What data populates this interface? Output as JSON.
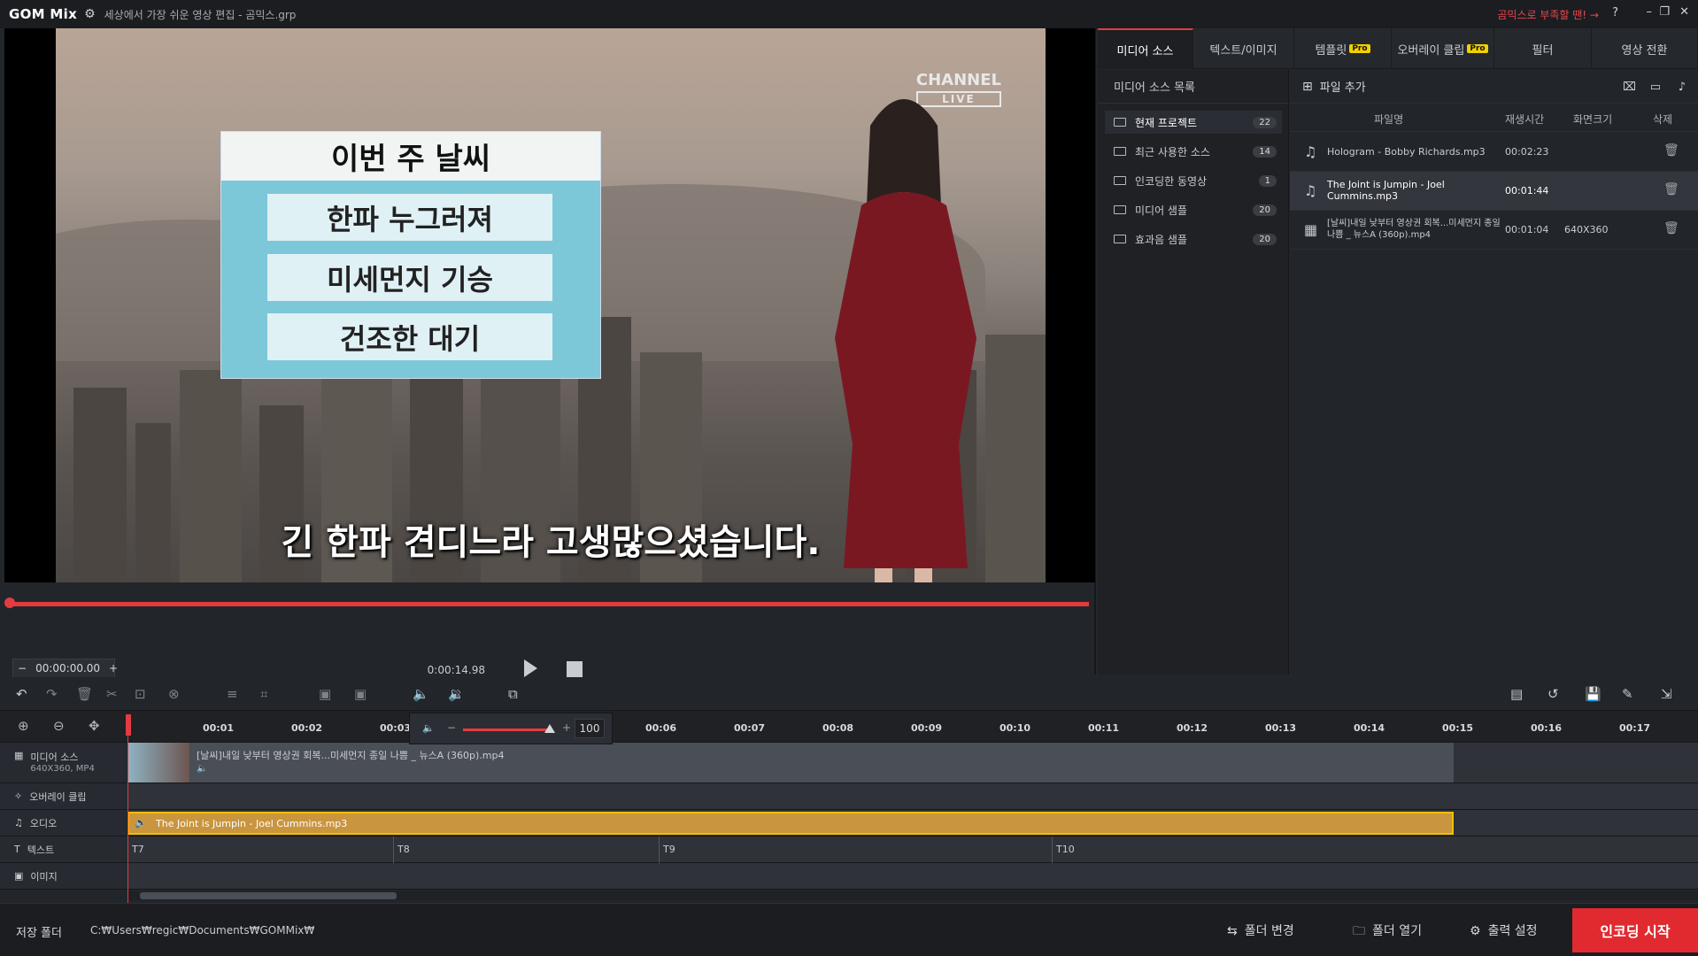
{
  "titlebar": {
    "logo": "GOM Mix",
    "title": "세상에서 가장 쉬운 영상 편집 - 곰믹스.grp",
    "promo": "곰믹스로 부족할 땐! →",
    "help": "?"
  },
  "preview": {
    "weather_title": "이번 주 날씨",
    "weather_items": [
      "한파 누그러져",
      "미세먼지 기승",
      "건조한 대기"
    ],
    "channel": "CHANNEL",
    "channel_live": "LIVE",
    "caption": "긴 한파 견디느라 고생많으셨습니다.",
    "timecode": "00:00:00.00",
    "duration": "0:00:14.98"
  },
  "tabs": [
    {
      "label": "미디어 소스",
      "pro": false
    },
    {
      "label": "텍스트/이미지",
      "pro": false
    },
    {
      "label": "템플릿",
      "pro": true
    },
    {
      "label": "오버레이 클립",
      "pro": true
    },
    {
      "label": "필터",
      "pro": false
    },
    {
      "label": "영상 전환",
      "pro": false
    }
  ],
  "pro_badge": "Pro",
  "folders": {
    "header": "미디어 소스 목록",
    "items": [
      {
        "label": "현재 프로젝트",
        "count": "22"
      },
      {
        "label": "최근 사용한 소스",
        "count": "14"
      },
      {
        "label": "인코딩한 동영상",
        "count": "1"
      },
      {
        "label": "미디어 샘플",
        "count": "20"
      },
      {
        "label": "효과음 샘플",
        "count": "20"
      }
    ]
  },
  "files": {
    "add_label": "파일 추가",
    "columns": {
      "name": "파일명",
      "duration": "재생시간",
      "size": "화면크기",
      "delete": "삭제"
    },
    "rows": [
      {
        "name": "Hologram - Bobby Richards.mp3",
        "duration": "00:02:23",
        "size": "",
        "type": "audio"
      },
      {
        "name": "The Joint is Jumpin - Joel Cummins.mp3",
        "duration": "00:01:44",
        "size": "",
        "type": "audio"
      },
      {
        "name": "[날씨]내일 낮부터 영상권 회복...미세먼지 종일 나쁨 _ 뉴스A (360p).mp4",
        "duration": "00:01:04",
        "size": "640X360",
        "type": "video"
      }
    ]
  },
  "timeline": {
    "ticks": [
      "00:01",
      "00:02",
      "00:03",
      "00:06",
      "00:07",
      "00:08",
      "00:09",
      "00:10",
      "00:11",
      "00:12",
      "00:13",
      "00:14",
      "00:15",
      "00:16",
      "00:17"
    ],
    "volume": "100",
    "tracks": {
      "media_label": "미디어 소스",
      "media_sub": "640X360, MP4",
      "overlay_label": "오버레이 클립",
      "audio_label": "오디오",
      "text_label": "텍스트",
      "image_label": "이미지"
    },
    "video_clip": "[날씨]내일 낮부터 영상권 회복...미세먼지 종일 나쁨 _ 뉴스A (360p).mp4",
    "audio_clip": "The Joint is Jumpin - Joel Cummins.mp3",
    "text_marks": [
      "T7",
      "T8",
      "T9",
      "T10"
    ]
  },
  "bottom": {
    "save_label": "저장 폴더",
    "save_path": "C:₩Users₩regic₩Documents₩GOMMix₩",
    "change_folder": "폴더 변경",
    "open_folder": "폴더 열기",
    "output_settings": "출력 설정",
    "encode": "인코딩 시작"
  },
  "colors": {
    "accent": "#e23c41",
    "audio_clip": "#c9953e",
    "pro": "#f2d000"
  }
}
